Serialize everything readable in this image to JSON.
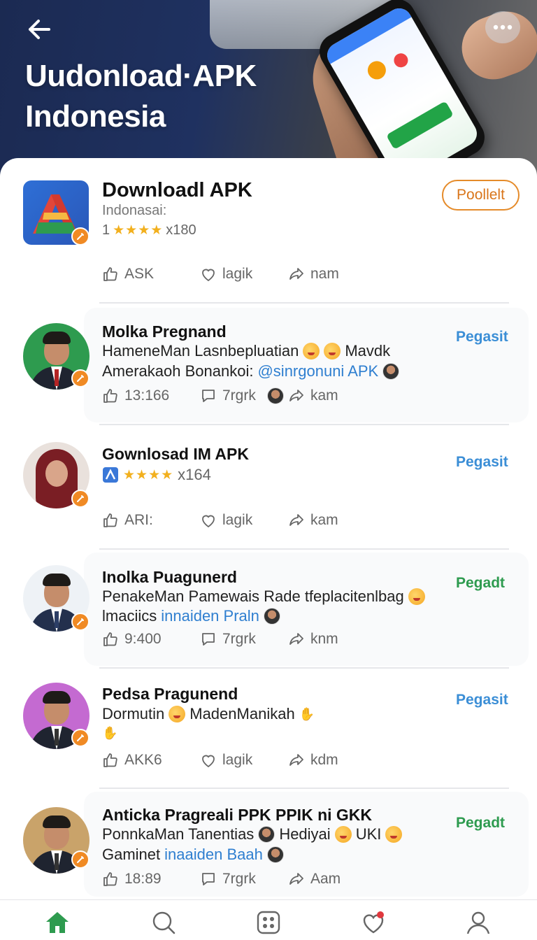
{
  "header": {
    "title_line1": "Uudonload·APK",
    "title_line2": "Indonesia",
    "back_icon": "arrow-left-icon",
    "more_icon": "more-dots-icon"
  },
  "featured": {
    "name": "Downloadl APK",
    "subtitle": "Indonasai:",
    "rating_prefix": "1",
    "stars": "★★★★",
    "rating_count": "x180",
    "follow_label": "Poollelt",
    "actions": {
      "like": "ASK",
      "heart": "lagik",
      "share": "nam"
    }
  },
  "posts": [
    {
      "title": "Molka Pregnand",
      "line1_a": "HameneMan Lasnbepluatian",
      "line1_b": "Mavdk",
      "line2_a": "Amerakaoh Bonankoi:",
      "line2_mention": "@sinrgonuni APK",
      "rank_label": "Pegasit",
      "rank_color": "#3b8ed6",
      "actions": {
        "like": "13:166",
        "comment": "7rgrk",
        "share": "kam"
      }
    },
    {
      "title": "Gownlosad IM APK",
      "stars": "★★★★",
      "rating_count": "x164",
      "rank_label": "Pegasit",
      "rank_color": "#3b8ed6",
      "actions": {
        "like": "ARI:",
        "heart": "lagik",
        "share": "kam"
      }
    },
    {
      "title": "Inolka Puagunerd",
      "line1_a": "PenakeMan Pamewais Rade tfeplacitenlbag",
      "line2_a": "lmaciics",
      "line2_mention": "innaiden Praln",
      "rank_label": "Pegadt",
      "rank_color": "#2e9b4f",
      "actions": {
        "like": "9:400",
        "comment": "7rgrk",
        "share": "knm"
      }
    },
    {
      "title": "Pedsa Pragunend",
      "line1_a": "Dormutin",
      "line1_b": "MadenManikah",
      "rank_label": "Pegasit",
      "rank_color": "#3b8ed6",
      "actions": {
        "like": "AKK6",
        "heart": "lagik",
        "share": "kdm"
      }
    },
    {
      "title": "Anticka Pragreali PPK PPIK ni GKK",
      "line1_a": "PonnkaMan Tanentias",
      "line1_b": "Hediyai",
      "line1_c": "UKI",
      "line2_a": "Gaminet",
      "line2_mention": "inaaiden Baah",
      "rank_label": "Pegadt",
      "rank_color": "#2e9b4f",
      "actions": {
        "like": "18:89",
        "comment": "7rgrk",
        "share": "Aam"
      }
    }
  ],
  "nav": {
    "items": [
      "home-icon",
      "search-icon",
      "apps-grid-icon",
      "heart-notification-icon",
      "profile-icon"
    ],
    "active_color": "#2e9b4f",
    "inactive_color": "#666666"
  },
  "colors": {
    "accent_orange": "#e58b2a",
    "link_blue": "#2f7fd0",
    "star_gold": "#f2b01e"
  }
}
